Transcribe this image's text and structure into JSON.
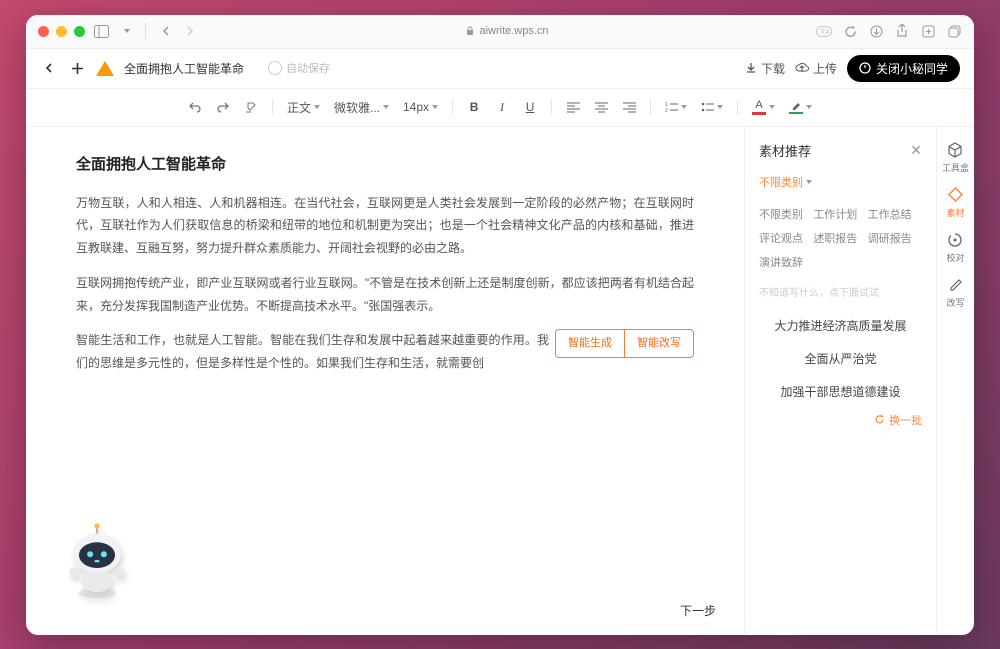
{
  "browser": {
    "url": "aiwrite.wps.cn"
  },
  "appbar": {
    "doc_title": "全面拥抱人工智能革命",
    "autosave": "自动保存",
    "download": "下载",
    "upload": "上传",
    "close_assistant": "关闭小秘同学"
  },
  "editor_toolbar": {
    "style_label": "正文",
    "font_label": "微软雅...",
    "size_label": "14px"
  },
  "document": {
    "h1": "全面拥抱人工智能革命",
    "p1": "万物互联，人和人相连、人和机器相连。在当代社会，互联网更是人类社会发展到一定阶段的必然产物；在互联网时代，互联社作为人们获取信息的桥梁和纽带的地位和机制更为突出；也是一个社会精神文化产品的内核和基础，推进互教联建、互融互努，努力提升群众素质能力、开阔社会视野的必由之路。",
    "p2": "互联网拥抱传统产业，即产业互联网或者行业互联网。\"不管是在技术创新上还是制度创新，都应该把两者有机结合起来，充分发挥我国制造产业优势。不断提高技术水平。\"张国强表示。",
    "p3": "智能生活和工作，也就是人工智能。智能在我们生存和发展中起着越来越重要的作用。我们的思维是多元性的，但是多样性是个性的。如果我们生存和生活，就需要创",
    "action_generate": "智能生成",
    "action_rewrite": "智能改写",
    "next_step": "下一步"
  },
  "materials": {
    "title": "素材推荐",
    "filter_label": "不限类别",
    "categories": [
      "不限类别",
      "工作计划",
      "工作总结",
      "评论观点",
      "述职报告",
      "调研报告",
      "演讲致辞"
    ],
    "hint": "不知道写什么，点下面试试",
    "suggestions": [
      "大力推进经济高质量发展",
      "全面从严治党",
      "加强干部思想道德建设"
    ],
    "refresh": "换一批"
  },
  "rail": {
    "toolbox": "工具盒",
    "material": "素材",
    "proof": "校对",
    "rewrite": "改写"
  }
}
